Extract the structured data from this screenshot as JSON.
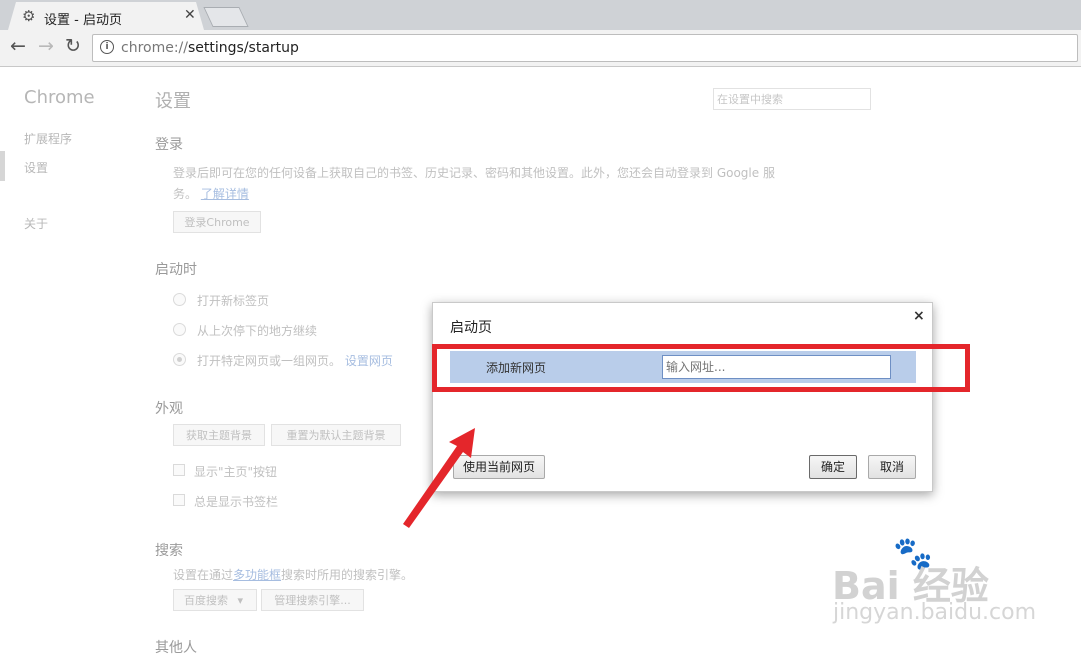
{
  "browser": {
    "tab_title": "设置 - 启动页",
    "tab_icon": "gear-icon",
    "tab_close": "✕",
    "url_scheme": "chrome://",
    "url_path": "settings/startup",
    "nav_back": "←",
    "nav_forward": "→",
    "nav_reload": "↻"
  },
  "sidebar": {
    "title": "Chrome",
    "items": [
      {
        "label": "扩展程序"
      },
      {
        "label": "设置"
      },
      {
        "label": "关于"
      }
    ]
  },
  "settings": {
    "title": "设置",
    "search_placeholder": "在设置中搜索",
    "login": {
      "heading": "登录",
      "desc_line1": "登录后即可在您的任何设备上获取自己的书签、历史记录、密码和其他设置。此外，您还会自动登录到 Google 服",
      "desc_line2_prefix": "务。",
      "learn_more": "了解详情",
      "button": "登录Chrome"
    },
    "startup": {
      "heading": "启动时",
      "options": [
        {
          "label": "打开新标签页"
        },
        {
          "label": "从上次停下的地方继续"
        },
        {
          "label": "打开特定网页或一组网页。"
        }
      ],
      "set_pages_link": "设置网页"
    },
    "appearance": {
      "heading": "外观",
      "get_themes": "获取主题背景",
      "reset_theme": "重置为默认主题背景",
      "show_home": "显示\"主页\"按钮",
      "show_bookmarks": "总是显示书签栏"
    },
    "search": {
      "heading": "搜索",
      "desc_prefix": "设置在通过",
      "desc_link": "多功能框",
      "desc_suffix": "搜索时所用的搜索引擎。",
      "engine": "百度搜索",
      "manage": "管理搜索引擎..."
    },
    "people": {
      "heading": "其他人"
    }
  },
  "dialog": {
    "title": "启动页",
    "close": "×",
    "row_label": "添加新网页",
    "url_placeholder": "输入网址...",
    "use_current": "使用当前网页",
    "ok": "确定",
    "cancel": "取消"
  },
  "annotation": {
    "highlight_color": "#e4262b"
  },
  "watermark": {
    "logo_text": "Bai  经验",
    "sub_text": "jingyan.baidu.com"
  }
}
